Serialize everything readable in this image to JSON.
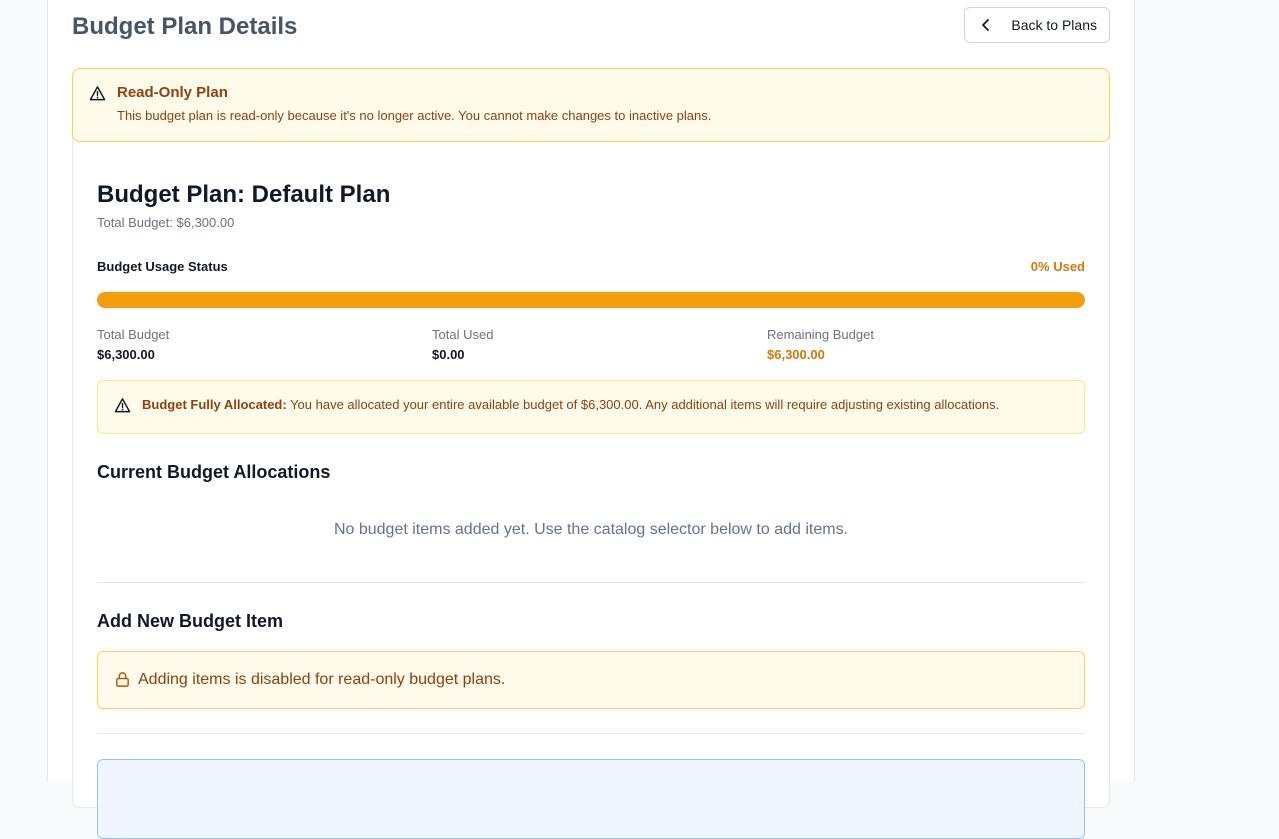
{
  "header": {
    "title": "Budget Plan Details",
    "back_label": "Back to Plans"
  },
  "readonly_banner": {
    "title": "Read-Only Plan",
    "description": "This budget plan is read-only because it's no longer active. You cannot make changes to inactive plans."
  },
  "plan": {
    "title": "Budget Plan: Default Plan",
    "total_line": "Total Budget: $6,300.00"
  },
  "usage": {
    "label": "Budget Usage Status",
    "percent_text": "0% Used",
    "percent_used": 0,
    "bar_color": "#f59e0b",
    "accent_color": "#d97706"
  },
  "stats": [
    {
      "label": "Total Budget",
      "value": "$6,300.00"
    },
    {
      "label": "Total Used",
      "value": "$0.00"
    },
    {
      "label": "Remaining Budget",
      "value": "$6,300.00"
    }
  ],
  "allocation_alert": {
    "bold": "Budget Fully Allocated:",
    "text": " You have allocated your entire available budget of $6,300.00. Any additional items will require adjusting existing allocations."
  },
  "allocations": {
    "heading": "Current Budget Allocations",
    "empty_message": "No budget items added yet. Use the catalog selector below to add items."
  },
  "add_item": {
    "heading": "Add New Budget Item",
    "disabled_message": "Adding items is disabled for read-only budget plans."
  },
  "icons": {
    "back": "chevron-left-icon",
    "warning": "warning-triangle-icon",
    "lock": "lock-icon"
  }
}
